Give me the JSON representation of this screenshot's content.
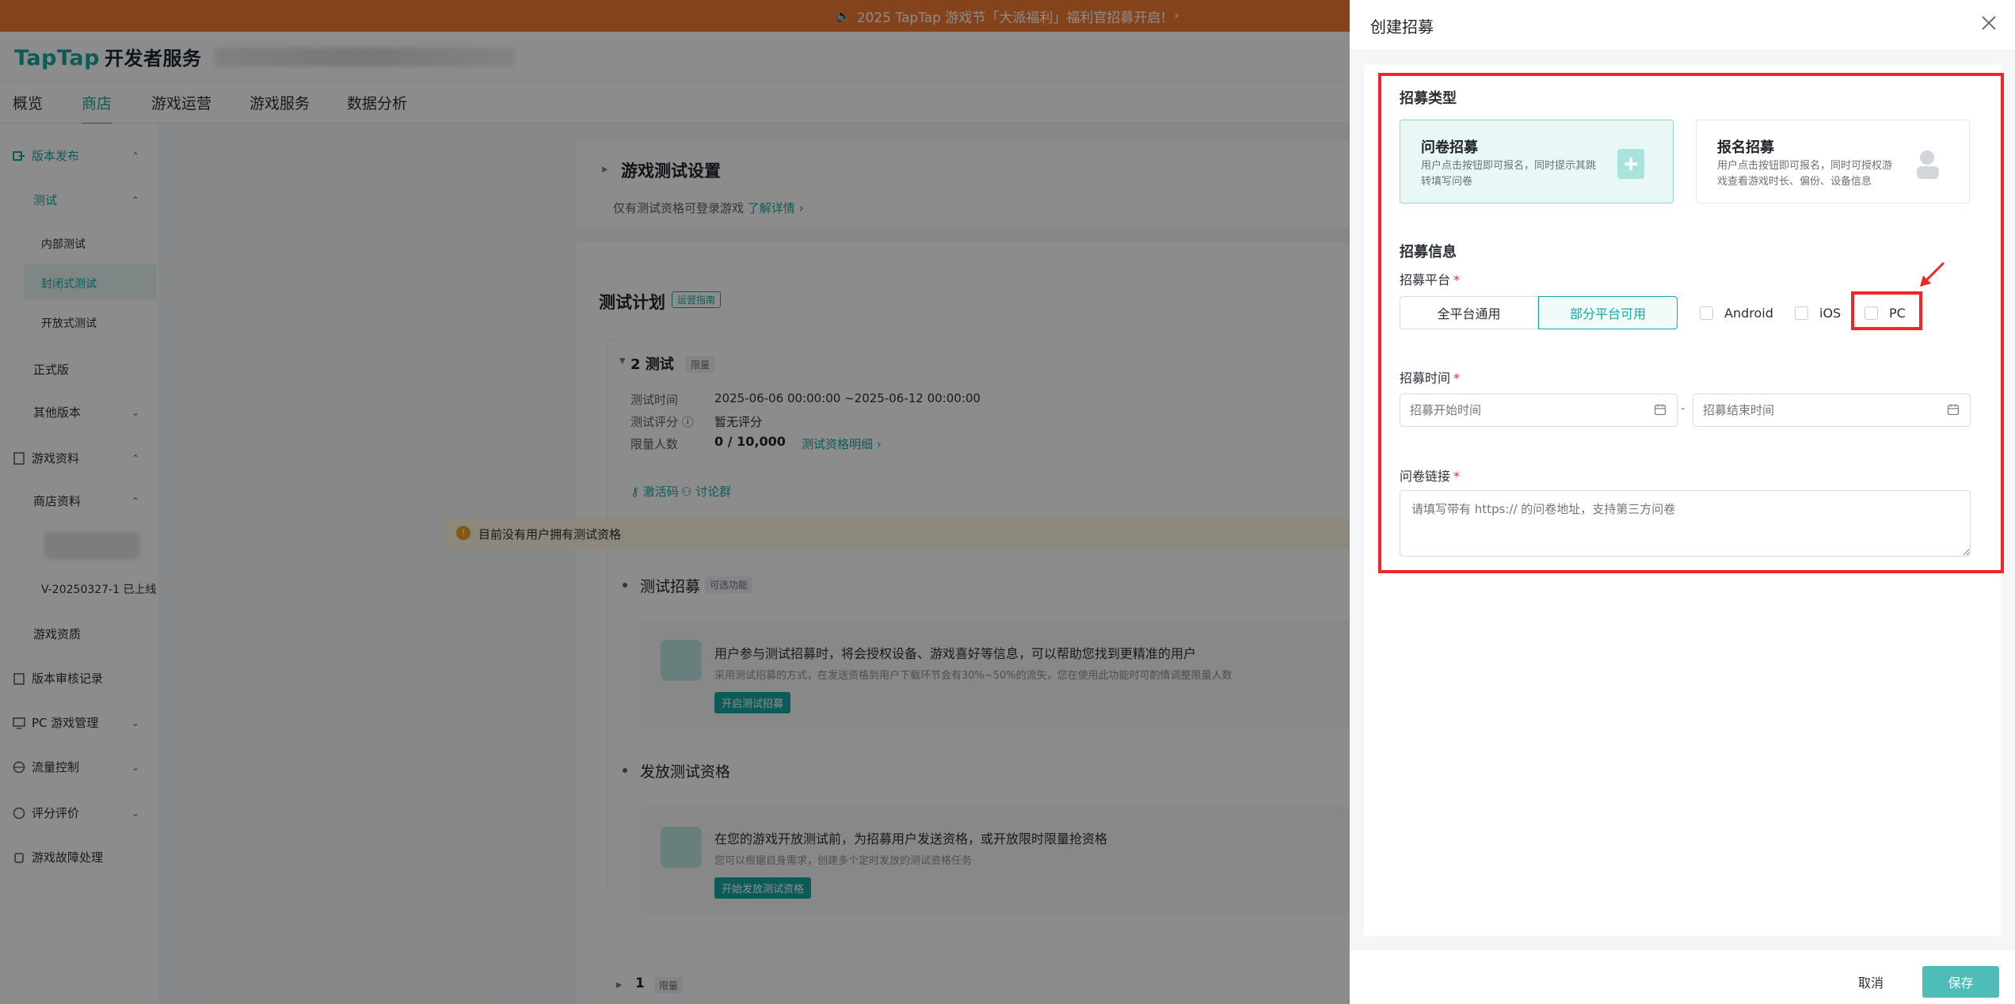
{
  "banner": {
    "text": "2025 TapTap 游戏节「大派福利」福利官招募开启!",
    "chevron": "›"
  },
  "header": {
    "logo_brand": "TapTap",
    "logo_text": "开发者服务"
  },
  "navtabs": [
    "概览",
    "商店",
    "游戏运营",
    "游戏服务",
    "数据分析"
  ],
  "sidebar": {
    "release": "版本发布",
    "test": "测试",
    "internal": "内部测试",
    "closed": "封闭式测试",
    "open": "开放式测试",
    "official": "正式版",
    "other": "其他版本",
    "game_info": "游戏资料",
    "store_info": "商店资料",
    "version_online": "V-20250327-1 已上线",
    "assets": "游戏资质",
    "review_log": "版本审核记录",
    "pc_manage": "PC 游戏管理",
    "traffic": "流量控制",
    "rating": "评分评价",
    "fault": "游戏故障处理"
  },
  "main": {
    "settings_title": "游戏测试设置",
    "settings_desc": "仅有测试资格可登录游戏",
    "settings_link": "了解详情 ›",
    "plan_title": "测试计划",
    "plan_tag": "运营指南",
    "test_name": "2 测试",
    "test_limit_tag": "限量",
    "time_label": "测试时间",
    "time_value": "2025-06-06 00:00:00 ~2025-06-12 00:00:00",
    "score_label": "测试评分 ⓘ",
    "score_value": "暂无评分",
    "limit_label": "限量人数",
    "limit_value": "0 / 10,000",
    "limit_link": "测试资格明细 ›",
    "code_link": "激活码",
    "group_link": "讨论群",
    "warning": "目前没有用户拥有测试资格",
    "recruit_title": "测试招募",
    "recruit_tag": "可选功能",
    "recruit_main": "用户参与测试招募时，将会授权设备、游戏喜好等信息，可以帮助您找到更精准的用户",
    "recruit_sub": "采用测试招募的方式，在发送资格到用户下载环节会有30%~50%的流失，您在使用此功能时可酌情调整限量人数",
    "recruit_btn": "开启测试招募",
    "grant_title": "发放测试资格",
    "grant_main": "在您的游戏开放测试前，为招募用户发送资格，或开放限时限量抢资格",
    "grant_sub": "您可以根据自身需求，创建多个定时发放的测试资格任务",
    "grant_btn": "开始发放测试资格",
    "test1_name": "1",
    "test1_tag": "限量"
  },
  "drawer": {
    "title": "创建招募",
    "type_section": "招募类型",
    "type_cards": [
      {
        "title": "问卷招募",
        "desc": "用户点击按钮即可报名，同时提示其跳转填写问卷"
      },
      {
        "title": "报名招募",
        "desc": "用户点击按钮即可报名，同时可授权游戏查看游戏时长、偏份、设备信息"
      }
    ],
    "info_section": "招募信息",
    "platform_label": "招募平台",
    "platform_segments": [
      "全平台通用",
      "部分平台可用"
    ],
    "platform_checks": [
      "Android",
      "iOS",
      "PC"
    ],
    "time_label": "招募时间",
    "start_placeholder": "招募开始时间",
    "end_placeholder": "招募结束时间",
    "separator": "-",
    "link_label": "问卷链接",
    "link_placeholder": "请填写带有 https:// 的问卷地址，支持第三方问卷",
    "cancel": "取消",
    "save": "保存",
    "required_mark": "*"
  },
  "colors": {
    "brand": "#14a8a0",
    "banner": "#f27a32",
    "highlight": "#f2262a"
  }
}
